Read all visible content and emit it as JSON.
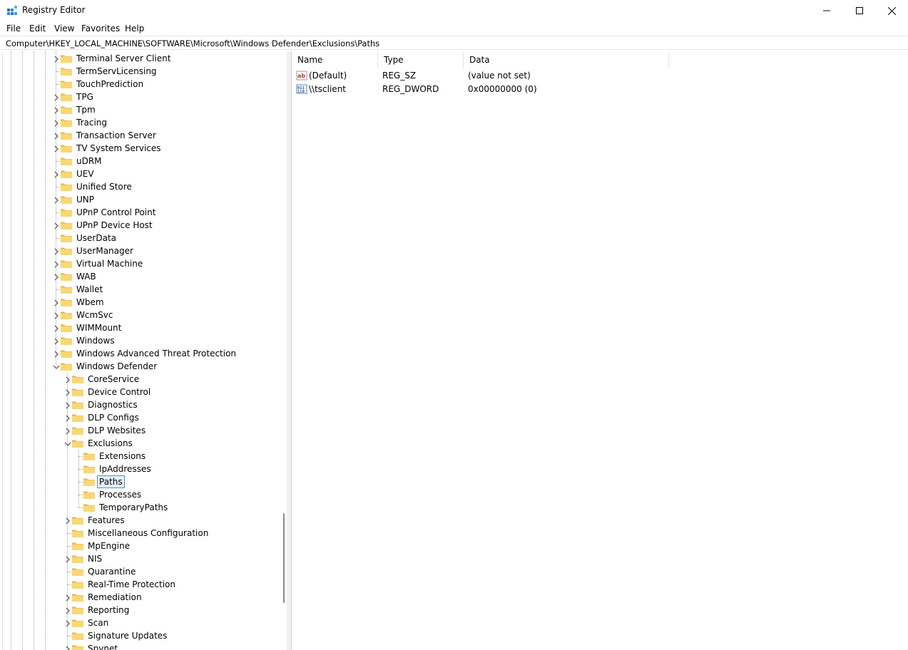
{
  "window": {
    "title": "Registry Editor"
  },
  "menu": [
    "File",
    "Edit",
    "View",
    "Favorites",
    "Help"
  ],
  "address": "Computer\\HKEY_LOCAL_MACHINE\\SOFTWARE\\Microsoft\\Windows Defender\\Exclusions\\Paths",
  "tree": {
    "top_level": [
      {
        "label": "Terminal Server Client",
        "expandable": true
      },
      {
        "label": "TermServLicensing",
        "expandable": false
      },
      {
        "label": "TouchPrediction",
        "expandable": false
      },
      {
        "label": "TPG",
        "expandable": true
      },
      {
        "label": "Tpm",
        "expandable": true
      },
      {
        "label": "Tracing",
        "expandable": true
      },
      {
        "label": "Transaction Server",
        "expandable": true
      },
      {
        "label": "TV System Services",
        "expandable": true
      },
      {
        "label": "uDRM",
        "expandable": false
      },
      {
        "label": "UEV",
        "expandable": true
      },
      {
        "label": "Unified Store",
        "expandable": false
      },
      {
        "label": "UNP",
        "expandable": true
      },
      {
        "label": "UPnP Control Point",
        "expandable": false
      },
      {
        "label": "UPnP Device Host",
        "expandable": true
      },
      {
        "label": "UserData",
        "expandable": false
      },
      {
        "label": "UserManager",
        "expandable": true
      },
      {
        "label": "Virtual Machine",
        "expandable": true
      },
      {
        "label": "WAB",
        "expandable": true
      },
      {
        "label": "Wallet",
        "expandable": false
      },
      {
        "label": "Wbem",
        "expandable": true
      },
      {
        "label": "WcmSvc",
        "expandable": true
      },
      {
        "label": "WIMMount",
        "expandable": true
      },
      {
        "label": "Windows",
        "expandable": true
      },
      {
        "label": "Windows Advanced Threat Protection",
        "expandable": true
      },
      {
        "label": "Windows Defender",
        "expandable": true,
        "expanded": true
      }
    ],
    "defender_children": [
      {
        "label": "CoreService",
        "expandable": true
      },
      {
        "label": "Device Control",
        "expandable": true
      },
      {
        "label": "Diagnostics",
        "expandable": true
      },
      {
        "label": "DLP Configs",
        "expandable": true
      },
      {
        "label": "DLP Websites",
        "expandable": true
      },
      {
        "label": "Exclusions",
        "expandable": true,
        "expanded": true
      },
      {
        "label": "Features",
        "expandable": true
      },
      {
        "label": "Miscellaneous Configuration",
        "expandable": false
      },
      {
        "label": "MpEngine",
        "expandable": false
      },
      {
        "label": "NIS",
        "expandable": true
      },
      {
        "label": "Quarantine",
        "expandable": false
      },
      {
        "label": "Real-Time Protection",
        "expandable": false
      },
      {
        "label": "Remediation",
        "expandable": true
      },
      {
        "label": "Reporting",
        "expandable": true
      },
      {
        "label": "Scan",
        "expandable": true
      },
      {
        "label": "Signature Updates",
        "expandable": false
      },
      {
        "label": "Spynet",
        "expandable": true
      }
    ],
    "exclusions_children": [
      {
        "label": "Extensions"
      },
      {
        "label": "IpAddresses"
      },
      {
        "label": "Paths",
        "selected": true
      },
      {
        "label": "Processes"
      },
      {
        "label": "TemporaryPaths"
      }
    ]
  },
  "list": {
    "columns": [
      "Name",
      "Type",
      "Data"
    ],
    "rows": [
      {
        "icon": "string-value-icon",
        "name": "(Default)",
        "type": "REG_SZ",
        "data": "(value not set)"
      },
      {
        "icon": "binary-value-icon",
        "name": "\\\\tsclient",
        "type": "REG_DWORD",
        "data": "0x00000000 (0)"
      }
    ]
  },
  "colors": {
    "folder": "#f8d775",
    "folder_dark": "#e8b73a",
    "selection_border": "#4a90d9"
  }
}
